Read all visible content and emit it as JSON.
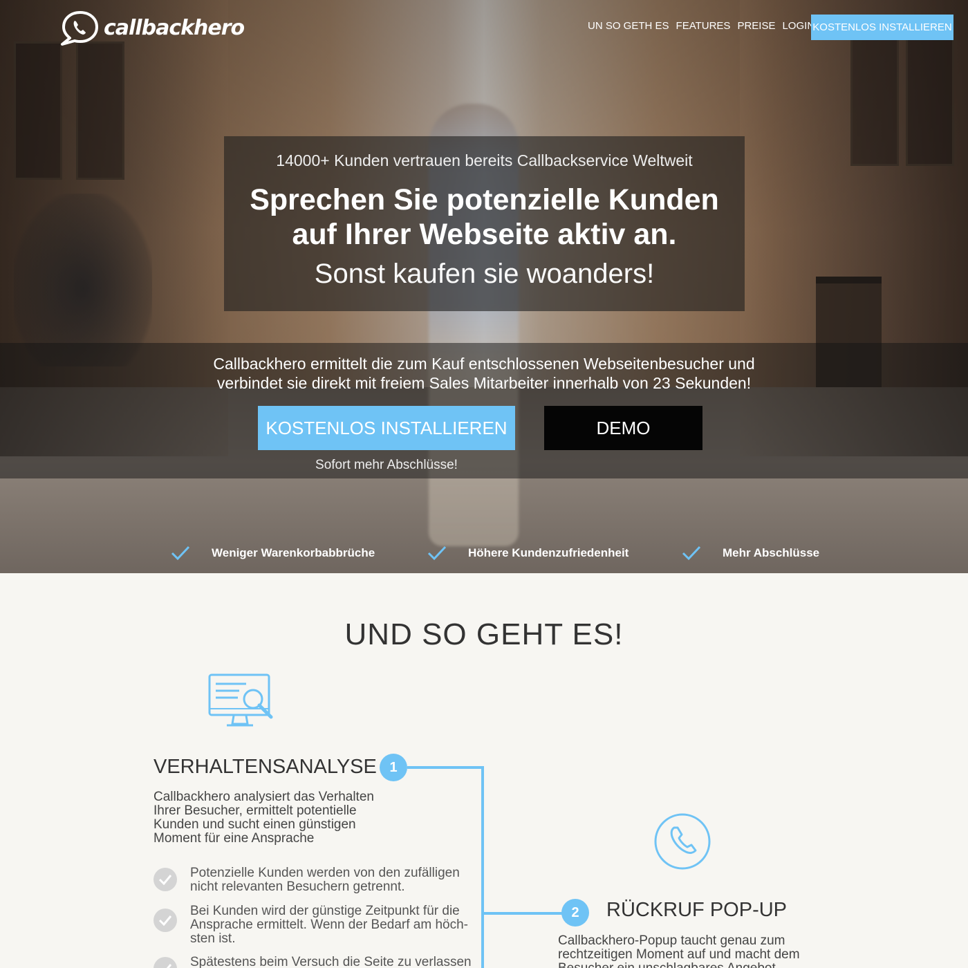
{
  "brand": {
    "name": "callbackhero",
    "accent": "#6fc3f5"
  },
  "nav": {
    "items": [
      "UN SO GETH ES",
      "FEATURES",
      "PREISE",
      "LOGIN"
    ],
    "cta": "KOSTENLOS INSTALLIEREN"
  },
  "hero": {
    "pretitle": "14000+ Kunden vertrauen bereits Callbackservice Weltweit",
    "title_line1": "Sprechen Sie potenzielle Kunden",
    "title_line2": "auf Ihrer Webseite aktiv an.",
    "subtitle": "Sonst kaufen sie woanders!",
    "description_line1": "Callbackhero ermittelt die zum Kauf entschlossenen Webseitenbesucher und",
    "description_line2": "verbindet sie direkt mit freiem Sales Mitarbeiter innerhalb von 23 Sekunden!",
    "install_button": "KOSTENLOS INSTALLIEREN",
    "demo_button": "DEMO",
    "tagline": "Sofort mehr Abschlüsse!"
  },
  "benefits": [
    "Weniger Warenkorbabbrüche",
    "Höhere Kundenzufriedenheit",
    "Mehr Abschlüsse"
  ],
  "section": {
    "title": "UND SO GEHT ES!",
    "steps": [
      {
        "number": "1",
        "title": "VERHALTENSANALYSE",
        "desc_lines": [
          "Callbackhero analysiert das Verhalten",
          "Ihrer Besucher, ermittelt potentielle",
          "Kunden und sucht einen günstigen",
          "Moment für eine Ansprache"
        ],
        "bullets": [
          [
            "Potenzielle Kunden werden von den zufälligen",
            "nicht relevanten Besuchern getrennt."
          ],
          [
            "Bei Kunden wird der günstige Zeitpunkt für die",
            "Ansprache ermittelt. Wenn der Bedarf am höch-",
            "sten ist."
          ],
          [
            "Spätestens beim Versuch die Seite zu verlassen"
          ]
        ]
      },
      {
        "number": "2",
        "title": "RÜCKRUF POP-UP",
        "desc_lines": [
          "Callbackhero-Popup  taucht genau zum",
          "rechtzeitigen Moment auf und macht dem",
          "Besucher ein unschlagbares Angebot"
        ]
      }
    ]
  }
}
